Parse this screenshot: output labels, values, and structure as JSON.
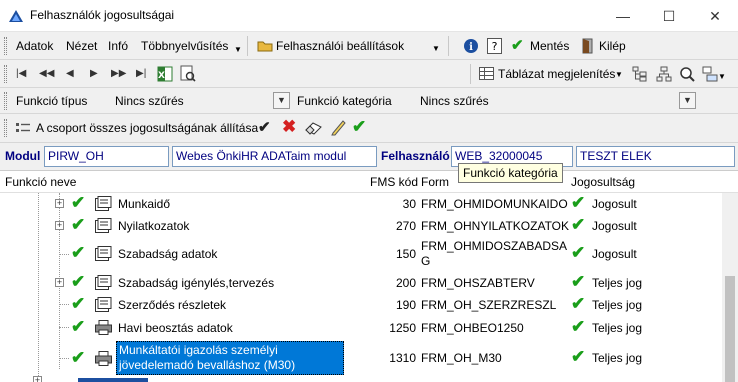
{
  "window": {
    "title": "Felhasználók jogosultságai"
  },
  "menu": {
    "items": [
      "Adatok",
      "Nézet",
      "Infó",
      "Többnyelvűsítés"
    ],
    "user_settings": "Felhasználói beállítások",
    "save": "Mentés",
    "exit": "Kilép"
  },
  "toolbar2": {
    "table_display": "Táblázat megjelenítés"
  },
  "filter": {
    "type_label": "Funkció típus",
    "type_value": "Nincs szűrés",
    "category_label": "Funkció kategória",
    "category_value": "Nincs szűrés"
  },
  "group_bar": {
    "label": "A csoport összes jogosultságának állítása"
  },
  "info": {
    "module_label": "Modul",
    "module_code": "PIRW_OH",
    "module_name": "Webes ÖnkiHR ADATaim modul",
    "user_label": "Felhasználó",
    "user_code": "WEB_32000045",
    "user_name": "TESZT ELEK"
  },
  "tooltip": "Funkció kategória",
  "grid": {
    "headers": {
      "name": "Funkció neve",
      "fms": "FMS kód",
      "form": "Form",
      "perm": "Jogosultság"
    },
    "rows": [
      {
        "name": "Munkaidő",
        "fms": "30",
        "form": "FRM_OHMIDOMUNKAIDO",
        "perm": "Jogosult"
      },
      {
        "name": "Nyilatkozatok",
        "fms": "270",
        "form": "FRM_OHNYILATKOZATOK",
        "perm": "Jogosult"
      },
      {
        "name": "Szabadság adatok",
        "fms": "150",
        "form": "FRM_OHMIDOSZABADSA",
        "form2": "G",
        "perm": "Jogosult"
      },
      {
        "name": "Szabadság igénylés,tervezés",
        "fms": "200",
        "form": "FRM_OHSZABTERV",
        "perm": "Teljes jog"
      },
      {
        "name": "Szerződés részletek",
        "fms": "190",
        "form": "FRM_OH_SZERZRESZL",
        "perm": "Teljes jog"
      },
      {
        "name": "Havi beosztás adatok",
        "fms": "1250",
        "form": "FRM_OHBEO1250",
        "perm": "Teljes jog"
      },
      {
        "name": "Munkáltatói igazolás személyi",
        "name2": "jövedelemadó bevalláshoz (M30)",
        "fms": "1310",
        "form": "FRM_OH_M30",
        "perm": "Teljes jog"
      }
    ]
  },
  "colors": {
    "accent": "#0078d7",
    "check": "#1a9e1a",
    "label_blue": "#000080"
  }
}
